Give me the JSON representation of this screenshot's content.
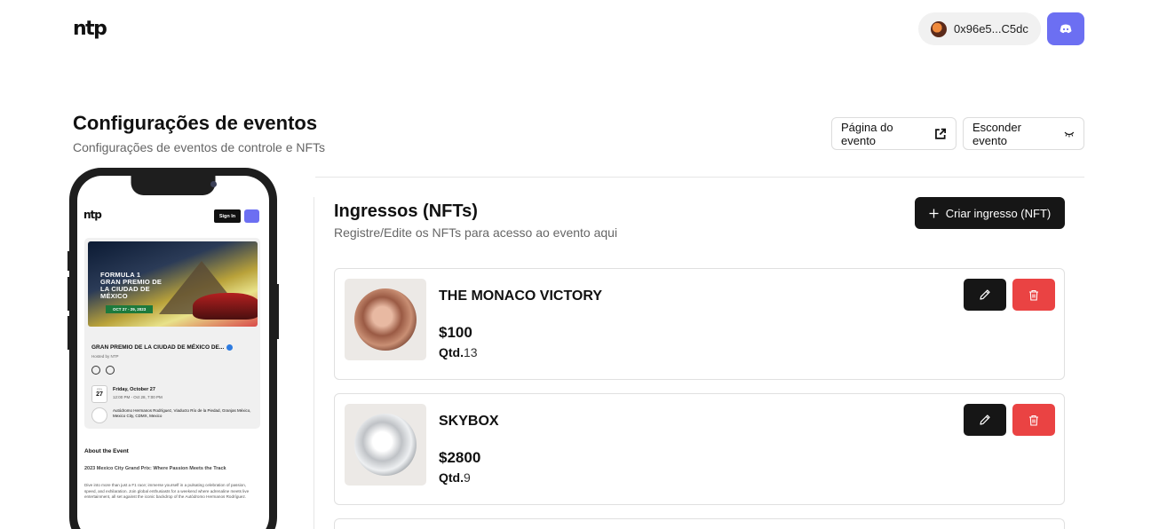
{
  "header": {
    "logo": "ntp",
    "wallet_address": "0x96e5...C5dc"
  },
  "page": {
    "title": "Configurações de eventos",
    "subtitle": "Configurações de eventos de controle e NFTs",
    "event_page_label": "Página do evento",
    "hide_event_label": "Esconder evento"
  },
  "preview": {
    "logo": "ntp",
    "sign_in": "Sign In",
    "banner_title": "FORMULA 1 GRAN PREMIO DE LA CIUDAD DE MÉXICO",
    "banner_date": "OCT 27 - 29, 2023",
    "event_title": "GRAN PREMIO DE LA CIUDAD DE MÉXICO DE...",
    "hosted_by": "Hosted by NTP",
    "date_month": "FRI",
    "date_day": "27",
    "date_line1": "Friday, October 27",
    "date_line2": "12:00 PM - Oct 28, 7:00 PM",
    "location": "Autódromo Hermanos Rodríguez, Viaducto Río de la Piedad, Granjas México, Mexico City, CDMX, Mexico",
    "about_title": "About the Event",
    "about_subtitle": "2023 Mexico City Grand Prix: Where Passion Meets the Track",
    "about_body": "Dive into more than just a F1 race; immerse yourself in a pulsating celebration of passion, speed, and exhilaration. Join global enthusiasts for a weekend where adrenaline meets live entertainment, all set against the iconic backdrop of the Autódromo Hermanos Rodríguez."
  },
  "tickets_section": {
    "title": "Ingressos (NFTs)",
    "subtitle": "Registre/Edite os NFTs para acesso ao evento aqui",
    "create_label": "Criar ingresso (NFT)",
    "qty_label": "Qtd.",
    "items": [
      {
        "name": "THE MONACO VICTORY",
        "price": "$100",
        "qty": "13"
      },
      {
        "name": "SKYBOX",
        "price": "$2800",
        "qty": "9"
      }
    ]
  },
  "colors": {
    "discord": "#6c6ff2",
    "delete": "#ea4343",
    "dark_button": "#161616"
  },
  "icons": [
    "wallet-avatar-icon",
    "discord-icon",
    "external-link-icon",
    "eye-closed-icon",
    "plus-icon",
    "pencil-icon",
    "trash-icon"
  ]
}
